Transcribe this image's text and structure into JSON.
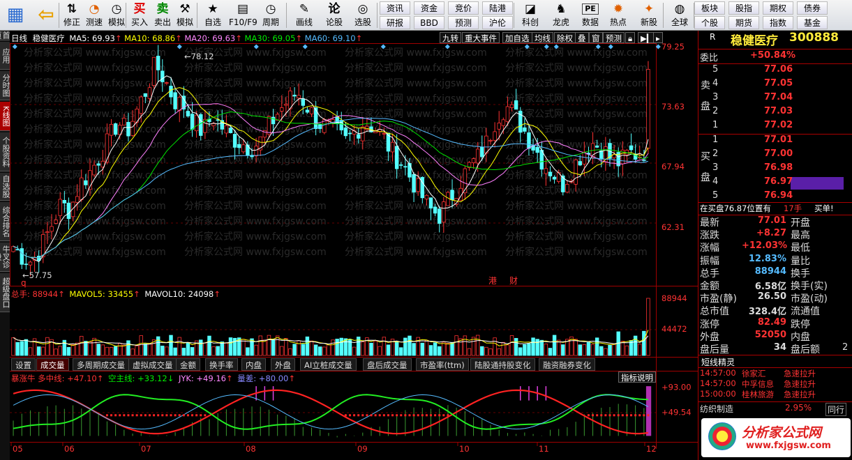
{
  "toolbar": {
    "buttons": [
      {
        "label": "",
        "icon": "app-grid-icon"
      },
      {
        "label": "",
        "icon": "back-arrow-icon"
      },
      {
        "label": "修正",
        "icon": "up-down-icon"
      },
      {
        "label": "测速",
        "icon": "speed-icon"
      },
      {
        "label": "模拟",
        "icon": "clock-icon"
      },
      {
        "label": "买入",
        "icon": "buy-icon",
        "glyph": "买"
      },
      {
        "label": "卖出",
        "icon": "sell-icon",
        "glyph": "卖"
      },
      {
        "label": "模拟",
        "icon": "hammer-icon"
      },
      {
        "label": "自选",
        "icon": "favorites-icon"
      },
      {
        "label": "F10/F9",
        "icon": "f10-icon"
      },
      {
        "label": "周期",
        "icon": "period-icon"
      },
      {
        "label": "画线",
        "icon": "pencil-icon"
      },
      {
        "label": "论股",
        "icon": "discuss-icon",
        "glyph": "论"
      },
      {
        "label": "选股",
        "icon": "stock-pick-icon"
      },
      {
        "label": "科创",
        "icon": "kechuang-icon"
      },
      {
        "label": "龙虎",
        "icon": "dragon-tiger-icon"
      },
      {
        "label": "数据",
        "icon": "data-icon",
        "glyph": "PE"
      },
      {
        "label": "热点",
        "icon": "hotspot-icon"
      },
      {
        "label": "新股",
        "icon": "new-stock-icon"
      },
      {
        "label": "全球",
        "icon": "globe-icon"
      }
    ],
    "grid_left": [
      [
        "资讯",
        "资金",
        "竞价",
        "陆港"
      ],
      [
        "研报",
        "BBD",
        "预测",
        "沪伦"
      ]
    ],
    "grid_right": [
      [
        "板块",
        "股指",
        "期权",
        "债券"
      ],
      [
        "个股",
        "期货",
        "指数",
        "基金"
      ]
    ]
  },
  "left_nav": [
    "首页",
    "应用",
    "分时图",
    "K线图",
    "个股资料",
    "自选股",
    "综合排名",
    "牛叉诊股",
    "超级盘口"
  ],
  "kline": {
    "header": {
      "period": "日线",
      "name": "稳健医疗",
      "ma5": "MA5: 69.93",
      "ma10": "MA10: 68.86",
      "ma20": "MA20: 69.63",
      "ma30": "MA30: 69.05",
      "ma60": "MA60: 69.10"
    },
    "right_buttons": [
      "九转",
      "重大事件",
      "加自选",
      "均线",
      "除权",
      "叠",
      "窗",
      "预测"
    ],
    "price_axis": [
      "79.25",
      "73.63",
      "67.94",
      "62.31"
    ],
    "high_label": "78.12",
    "low_label": "57.75",
    "markers": [
      "q",
      "港",
      "财"
    ],
    "vol_header": {
      "total": "总手: 88944",
      "mavol5": "MAVOL5: 33455",
      "mavol10": "MAVOL10: 24098"
    },
    "vol_axis": [
      "88944",
      "44472"
    ],
    "tabs": [
      "设置",
      "成交量",
      "多周期成交量",
      "虚拟成交量",
      "金额",
      "换手率",
      "内盘",
      "外盘",
      "AI立桩成交量",
      "盘后成交量",
      "市盈率(ttm)",
      "陆股通持股变化",
      "融资融券变化"
    ],
    "ind_header": {
      "a": "暴涨牛 多中线: +47.10",
      "b": "空主线: +33.12",
      "c": "JYK: +49.16",
      "d": "量差: +80.00"
    },
    "ind_button": "指标说明",
    "ind_axis": [
      "+93.00",
      "+49.54"
    ],
    "x_axis": [
      "05",
      "06",
      "07",
      "08",
      "09",
      "10",
      "11",
      "12"
    ],
    "watermark": "分析家公式网 www.fxjgsw.com"
  },
  "quote": {
    "code_prefix": "R",
    "name": "稳健医疗",
    "code": "300888",
    "weibi_label": "委比",
    "weibi": "+50.84%",
    "sell_label": "卖盘",
    "buy_label": "买盘",
    "asks": [
      {
        "n": "5",
        "p": "77.06"
      },
      {
        "n": "4",
        "p": "77.05"
      },
      {
        "n": "3",
        "p": "77.04"
      },
      {
        "n": "2",
        "p": "77.03"
      },
      {
        "n": "1",
        "p": "77.02"
      }
    ],
    "bids": [
      {
        "n": "1",
        "p": "77.01"
      },
      {
        "n": "2",
        "p": "77.00"
      },
      {
        "n": "3",
        "p": "76.98"
      },
      {
        "n": "4",
        "p": "76.97"
      },
      {
        "n": "5",
        "p": "76.94"
      }
    ],
    "status": "在买盘76.87位置有",
    "status_qty": "17手",
    "status_act": "买单!",
    "stats": [
      [
        "最新",
        "77.01",
        "开盘",
        ""
      ],
      [
        "涨跌",
        "+8.27",
        "最高",
        ""
      ],
      [
        "涨幅",
        "+12.03%",
        "最低",
        ""
      ],
      [
        "振幅",
        "12.83%",
        "量比",
        ""
      ],
      [
        "总手",
        "88944",
        "换手",
        ""
      ],
      [
        "金额",
        "6.58亿",
        "换手(实)",
        ""
      ],
      [
        "市盈(静)",
        "26.50",
        "市盈(动)",
        ""
      ],
      [
        "总市值",
        "328.4亿",
        "流通值",
        ""
      ],
      [
        "涨停",
        "82.49",
        "跌停",
        ""
      ],
      [
        "外盘",
        "52050",
        "内盘",
        ""
      ],
      [
        "盘后量",
        "34",
        "盘后额",
        "2"
      ]
    ],
    "elf_title": "短线精灵",
    "elf": [
      [
        "14:57:00",
        "徐家汇",
        "急速拉升"
      ],
      [
        "14:57:00",
        "中孚信息",
        "急速拉升"
      ],
      [
        "15:00:00",
        "桂林旅游",
        "急速拉升"
      ]
    ],
    "bottom": {
      "name": "纺织制造",
      "pct": "2.95%",
      "tag": "同行"
    },
    "brand": "分析家公式网",
    "brand_url": "www.fxjgsw.com"
  },
  "colors": {
    "up": "#ff3232",
    "down": "#54ffff",
    "ma5": "#ffffff",
    "ma10": "#ffff00",
    "ma20": "#ff80ff",
    "ma30": "#00e600",
    "ma60": "#55bbff",
    "axis": "#a00000"
  }
}
